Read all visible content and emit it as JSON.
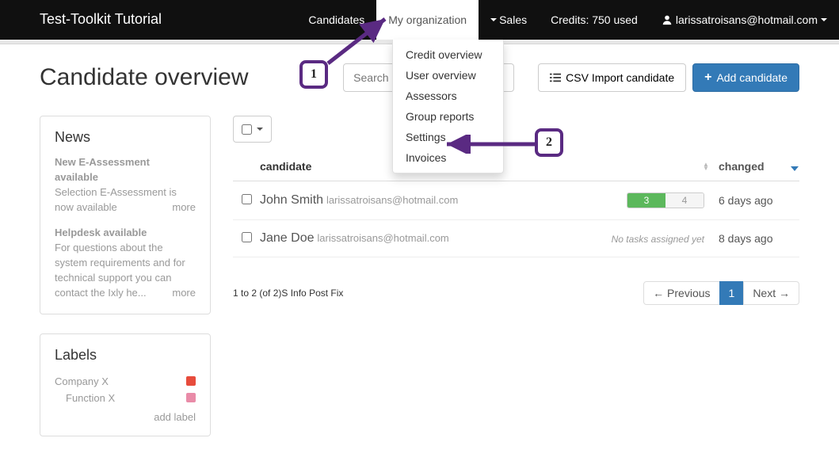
{
  "navbar": {
    "brand": "Test-Toolkit Tutorial",
    "candidates": "Candidates",
    "my_org": "My organization",
    "sales": "Sales",
    "credits": "Credits: 750 used",
    "user": "larissatroisans@hotmail.com"
  },
  "dropdown": {
    "credit_overview": "Credit overview",
    "user_overview": "User overview",
    "assessors": "Assessors",
    "group_reports": "Group reports",
    "settings": "Settings",
    "invoices": "Invoices"
  },
  "page": {
    "title": "Candidate overview",
    "search_placeholder": "Search",
    "csv_import": "CSV Import candidate",
    "add_candidate": "Add candidate"
  },
  "sidebar": {
    "news_title": "News",
    "news": [
      {
        "title": "New E-Assessment available",
        "body": "Selection E-Assessment is now available",
        "more": "more"
      },
      {
        "title": "Helpdesk available",
        "body": "For questions about the system requirements and for technical support you can contact the Ixly he...",
        "more": "more"
      }
    ],
    "labels_title": "Labels",
    "labels": [
      {
        "name": "Company X",
        "color": "#e74c3c",
        "indent": false
      },
      {
        "name": "Function X",
        "color": "#e98ba8",
        "indent": true
      }
    ],
    "add_label": "add label"
  },
  "table": {
    "head_candidate": "candidate",
    "head_changed": "changed",
    "rows": [
      {
        "name": "John Smith",
        "email": "larissatroisans@hotmail.com",
        "status_a": "3",
        "status_b": "4",
        "changed": "6 days ago",
        "has_tasks": true
      },
      {
        "name": "Jane Doe",
        "email": "larissatroisans@hotmail.com",
        "no_tasks": "No tasks assigned yet",
        "changed": "8 days ago",
        "has_tasks": false
      }
    ],
    "count": "1 to 2 (of 2)",
    "postfix": "S Info Post Fix",
    "prev": "← Previous",
    "page1": "1",
    "next": "Next →"
  },
  "callouts": {
    "one": "1",
    "two": "2"
  }
}
